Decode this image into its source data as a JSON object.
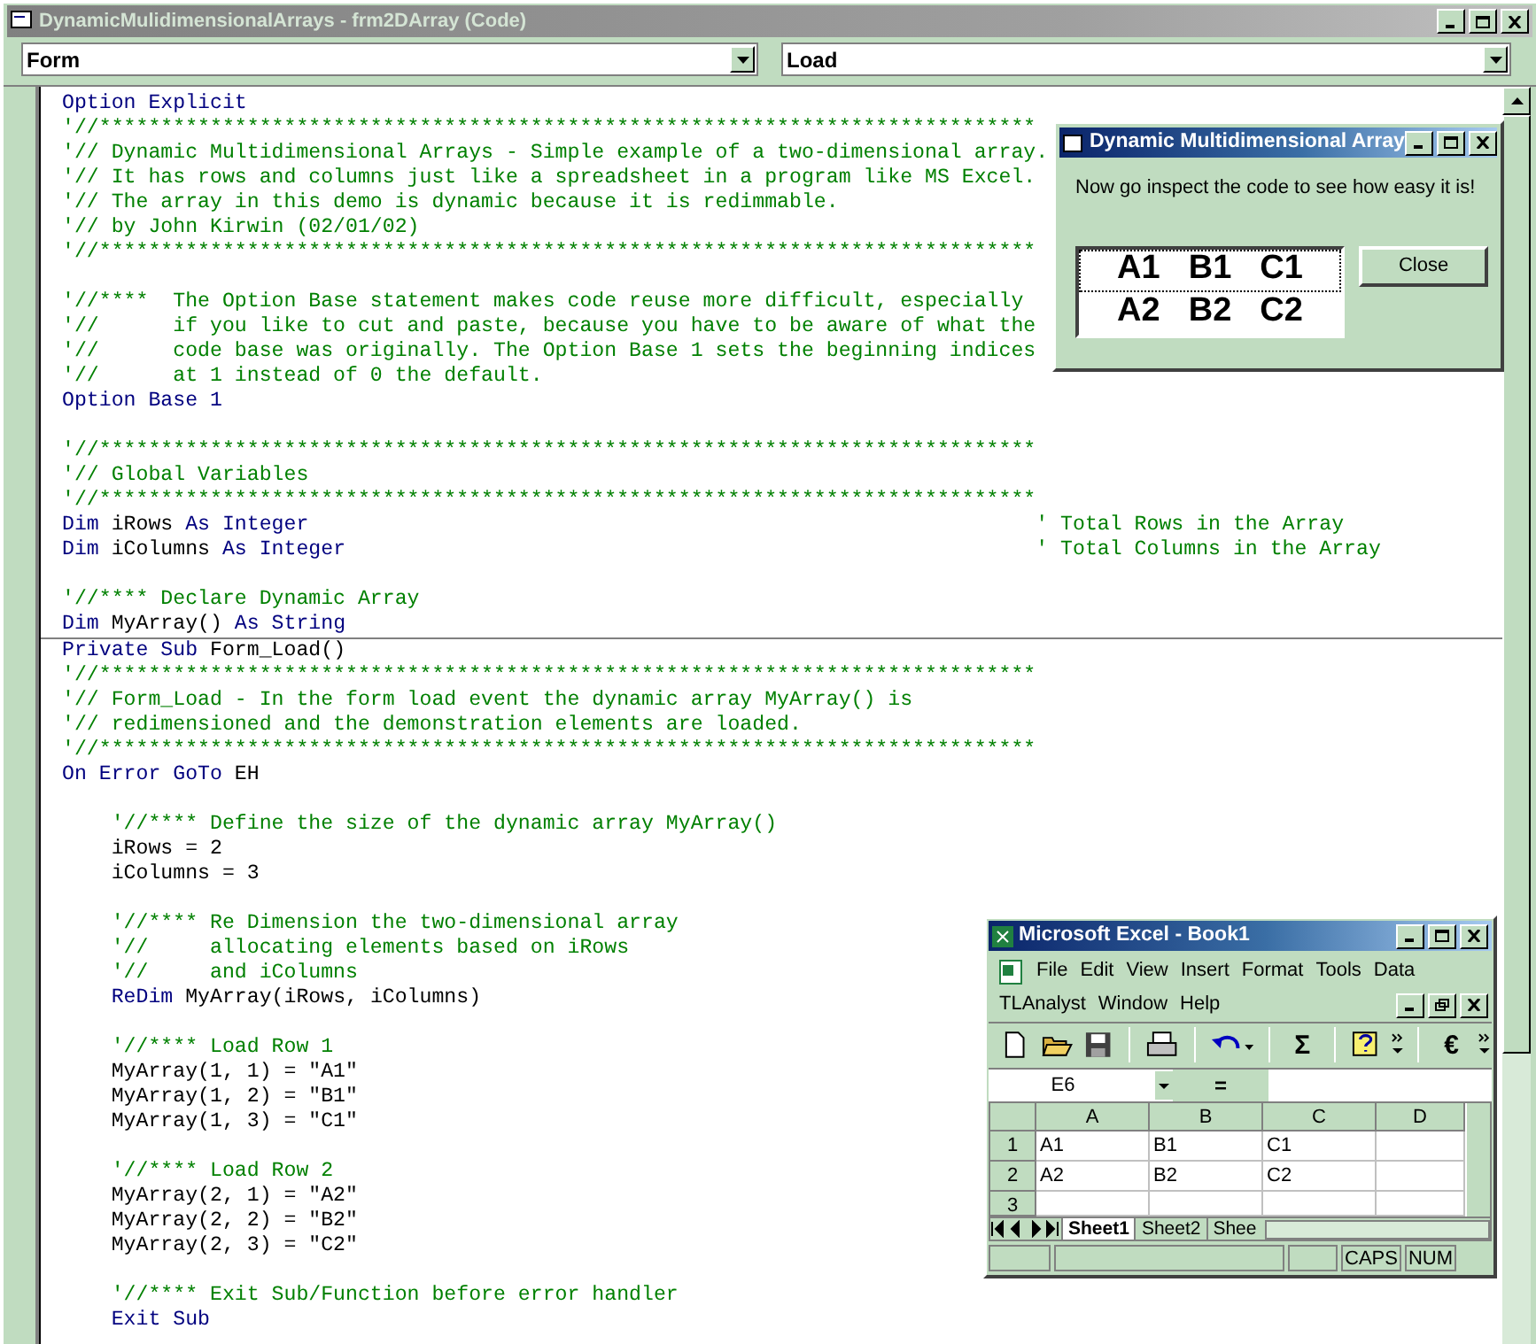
{
  "window": {
    "title": "DynamicMulidimensionalArrays - frm2DArray (Code)"
  },
  "object_box": {
    "value": "Form"
  },
  "procedure_box": {
    "value": "Load"
  },
  "procedures": [
    {
      "lines": [
        {
          "kind": "code",
          "parts": [
            {
              "kind": "keyword",
              "text": "Option Explicit"
            }
          ]
        },
        {
          "kind": "code",
          "parts": [
            {
              "kind": "comment",
              "text": "'//****************************************************************************"
            }
          ]
        },
        {
          "kind": "code",
          "parts": [
            {
              "kind": "comment",
              "text": "'// Dynamic Multidimensional Arrays - Simple example of a two-dimensional array."
            }
          ]
        },
        {
          "kind": "code",
          "parts": [
            {
              "kind": "comment",
              "text": "'// It has rows and columns just like a spreadsheet in a program like MS Excel."
            }
          ]
        },
        {
          "kind": "code",
          "parts": [
            {
              "kind": "comment",
              "text": "'// The array in this demo is dynamic because it is redimmable."
            }
          ]
        },
        {
          "kind": "code",
          "parts": [
            {
              "kind": "comment",
              "text": "'// by John Kirwin (02/01/02)"
            }
          ]
        },
        {
          "kind": "code",
          "parts": [
            {
              "kind": "comment",
              "text": "'//****************************************************************************"
            }
          ]
        },
        {
          "kind": "blank"
        },
        {
          "kind": "code",
          "parts": [
            {
              "kind": "comment",
              "text": "'//****  The Option Base statement makes code reuse more difficult, especially"
            }
          ]
        },
        {
          "kind": "code",
          "parts": [
            {
              "kind": "comment",
              "text": "'//      if you like to cut and paste, because you have to be aware of what the"
            }
          ]
        },
        {
          "kind": "code",
          "parts": [
            {
              "kind": "comment",
              "text": "'//      code base was originally. The Option Base 1 sets the beginning indices"
            }
          ]
        },
        {
          "kind": "code",
          "parts": [
            {
              "kind": "comment",
              "text": "'//      at 1 instead of 0 the default."
            }
          ]
        },
        {
          "kind": "code",
          "parts": [
            {
              "kind": "keyword",
              "text": "Option Base 1"
            }
          ]
        },
        {
          "kind": "blank"
        },
        {
          "kind": "code",
          "parts": [
            {
              "kind": "comment",
              "text": "'//****************************************************************************"
            }
          ]
        },
        {
          "kind": "code",
          "parts": [
            {
              "kind": "comment",
              "text": "'// Global Variables"
            }
          ]
        },
        {
          "kind": "code",
          "parts": [
            {
              "kind": "comment",
              "text": "'//****************************************************************************"
            }
          ]
        },
        {
          "kind": "code",
          "parts": [
            {
              "kind": "keyword",
              "text": "Dim "
            },
            {
              "kind": "plain",
              "text": "iRows "
            },
            {
              "kind": "keyword",
              "text": "As Integer"
            },
            {
              "kind": "trailing_comment",
              "text": "' Total Rows in the Array"
            }
          ]
        },
        {
          "kind": "code",
          "parts": [
            {
              "kind": "keyword",
              "text": "Dim "
            },
            {
              "kind": "plain",
              "text": "iColumns "
            },
            {
              "kind": "keyword",
              "text": "As Integer"
            },
            {
              "kind": "trailing_comment",
              "text": "' Total Columns in the Array"
            }
          ]
        },
        {
          "kind": "blank"
        },
        {
          "kind": "code",
          "parts": [
            {
              "kind": "comment",
              "text": "'//**** Declare Dynamic Array"
            }
          ]
        },
        {
          "kind": "code",
          "parts": [
            {
              "kind": "keyword",
              "text": "Dim "
            },
            {
              "kind": "plain",
              "text": "MyArray() "
            },
            {
              "kind": "keyword",
              "text": "As String"
            }
          ]
        }
      ]
    },
    {
      "lines": [
        {
          "kind": "code",
          "parts": [
            {
              "kind": "keyword",
              "text": "Private Sub "
            },
            {
              "kind": "plain",
              "text": "Form_Load()"
            }
          ]
        },
        {
          "kind": "code",
          "parts": [
            {
              "kind": "comment",
              "text": "'//****************************************************************************"
            }
          ]
        },
        {
          "kind": "code",
          "parts": [
            {
              "kind": "comment",
              "text": "'// Form_Load - In the form load event the dynamic array MyArray() is"
            }
          ]
        },
        {
          "kind": "code",
          "parts": [
            {
              "kind": "comment",
              "text": "'// redimensioned and the demonstration elements are loaded."
            }
          ]
        },
        {
          "kind": "code",
          "parts": [
            {
              "kind": "comment",
              "text": "'//****************************************************************************"
            }
          ]
        },
        {
          "kind": "code",
          "parts": [
            {
              "kind": "keyword",
              "text": "On Error GoTo "
            },
            {
              "kind": "plain",
              "text": "EH"
            }
          ]
        },
        {
          "kind": "blank"
        },
        {
          "kind": "code",
          "parts": [
            {
              "kind": "comment",
              "text": "    '//**** Define the size of the dynamic array MyArray()"
            }
          ]
        },
        {
          "kind": "code",
          "parts": [
            {
              "kind": "plain",
              "text": "    iRows = 2"
            }
          ]
        },
        {
          "kind": "code",
          "parts": [
            {
              "kind": "plain",
              "text": "    iColumns = 3"
            }
          ]
        },
        {
          "kind": "blank"
        },
        {
          "kind": "code",
          "parts": [
            {
              "kind": "comment",
              "text": "    '//**** Re Dimension the two-dimensional array"
            }
          ]
        },
        {
          "kind": "code",
          "parts": [
            {
              "kind": "comment",
              "text": "    '//     allocating elements based on iRows"
            }
          ]
        },
        {
          "kind": "code",
          "parts": [
            {
              "kind": "comment",
              "text": "    '//     and iColumns"
            }
          ]
        },
        {
          "kind": "code",
          "parts": [
            {
              "kind": "keyword",
              "text": "    ReDim "
            },
            {
              "kind": "plain",
              "text": "MyArray(iRows, iColumns)"
            }
          ]
        },
        {
          "kind": "blank"
        },
        {
          "kind": "code",
          "parts": [
            {
              "kind": "comment",
              "text": "    '//**** Load Row 1"
            }
          ]
        },
        {
          "kind": "code",
          "parts": [
            {
              "kind": "plain",
              "text": "    MyArray(1, 1) = \"A1\""
            }
          ]
        },
        {
          "kind": "code",
          "parts": [
            {
              "kind": "plain",
              "text": "    MyArray(1, 2) = \"B1\""
            }
          ]
        },
        {
          "kind": "code",
          "parts": [
            {
              "kind": "plain",
              "text": "    MyArray(1, 3) = \"C1\""
            }
          ]
        },
        {
          "kind": "blank"
        },
        {
          "kind": "code",
          "parts": [
            {
              "kind": "comment",
              "text": "    '//**** Load Row 2"
            }
          ]
        },
        {
          "kind": "code",
          "parts": [
            {
              "kind": "plain",
              "text": "    MyArray(2, 1) = \"A2\""
            }
          ]
        },
        {
          "kind": "code",
          "parts": [
            {
              "kind": "plain",
              "text": "    MyArray(2, 2) = \"B2\""
            }
          ]
        },
        {
          "kind": "code",
          "parts": [
            {
              "kind": "plain",
              "text": "    MyArray(2, 3) = \"C2\""
            }
          ]
        },
        {
          "kind": "blank"
        },
        {
          "kind": "code",
          "parts": [
            {
              "kind": "comment",
              "text": "    '//**** Exit Sub/Function before error handler"
            }
          ]
        },
        {
          "kind": "code",
          "parts": [
            {
              "kind": "keyword",
              "text": "    Exit Sub"
            }
          ]
        }
      ]
    }
  ],
  "dialog": {
    "title": "Dynamic Multidimensional Array",
    "message": "Now go inspect the code to see how easy it is!",
    "grid": [
      {
        "cells": [
          "A1",
          "B1",
          "C1"
        ],
        "selected": true
      },
      {
        "cells": [
          "A2",
          "B2",
          "C2"
        ],
        "selected": false
      }
    ],
    "button": "Close"
  },
  "excel": {
    "title": "Microsoft Excel - Book1",
    "menu_rows": [
      [
        "File",
        "Edit",
        "View",
        "Insert",
        "Format",
        "Tools",
        "Data"
      ],
      [
        "TLAnalyst",
        "Window",
        "Help"
      ]
    ],
    "toolbar": [
      {
        "kind": "new"
      },
      {
        "kind": "open"
      },
      {
        "kind": "save"
      },
      {
        "kind": "sep"
      },
      {
        "kind": "print"
      },
      {
        "kind": "sep"
      },
      {
        "kind": "undo"
      },
      {
        "kind": "sep"
      },
      {
        "kind": "text",
        "label": "Σ"
      },
      {
        "kind": "sep"
      },
      {
        "kind": "help"
      },
      {
        "kind": "more"
      },
      {
        "kind": "sep"
      },
      {
        "kind": "text",
        "label": "€"
      },
      {
        "kind": "more"
      }
    ],
    "name_box": "E6",
    "formula_sign": "=",
    "columns": [
      "A",
      "B",
      "C",
      "D"
    ],
    "rows": [
      {
        "header": "1",
        "cells": [
          "A1",
          "B1",
          "C1",
          ""
        ]
      },
      {
        "header": "2",
        "cells": [
          "A2",
          "B2",
          "C2",
          ""
        ]
      },
      {
        "header": "3",
        "cells": [
          "",
          "",
          "",
          ""
        ]
      }
    ],
    "sheets": [
      {
        "label": "Sheet1",
        "selected": true
      },
      {
        "label": "Sheet2",
        "selected": false
      },
      {
        "label": "Shee",
        "selected": false
      }
    ],
    "status": [
      "CAPS",
      "NUM"
    ]
  }
}
